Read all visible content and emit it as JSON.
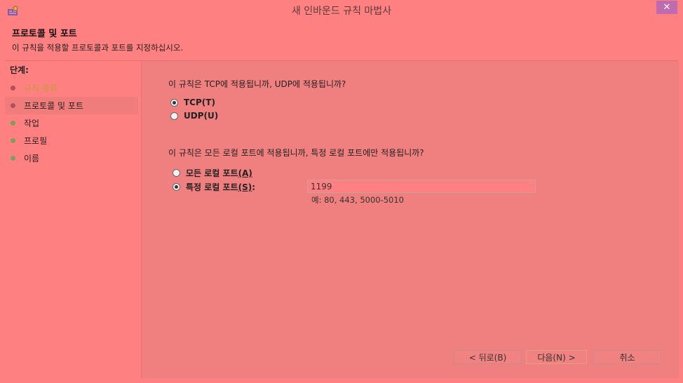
{
  "window": {
    "title": "새 인바운드 규칙 마법사",
    "close_label": "✕"
  },
  "header": {
    "title": "프로토콜 및 포트",
    "subtitle": "이 규칙을 적용할 프로토콜과 포트를 지정하십시오."
  },
  "steps": {
    "title": "단계:",
    "items": [
      {
        "label": "규칙 종류",
        "state": "done"
      },
      {
        "label": "프로토콜 및 포트",
        "state": "current"
      },
      {
        "label": "작업",
        "state": "todo"
      },
      {
        "label": "프로필",
        "state": "todo"
      },
      {
        "label": "이름",
        "state": "todo"
      }
    ]
  },
  "protocol": {
    "question": "이 규칙은 TCP에 적용됩니까, UDP에 적용됩니까?",
    "tcp_label": "TCP(T)",
    "udp_label": "UDP(U)",
    "selected": "tcp"
  },
  "ports": {
    "question": "이 규칙은 모든 로컬 포트에 적용됩니까, 특정 로컬 포트에만 적용됩니까?",
    "all_label_text": "모든 로컬 포트",
    "all_label_key": "(A)",
    "specific_label_text": "특정 로컬 포트",
    "specific_label_key": "(S)",
    "specific_label_suffix": ":",
    "selected": "specific",
    "value": "1199",
    "example": "예: 80, 443, 5000-5010"
  },
  "buttons": {
    "back": "< 뒤로(B)",
    "next": "다음(N) >",
    "cancel": "취소"
  }
}
